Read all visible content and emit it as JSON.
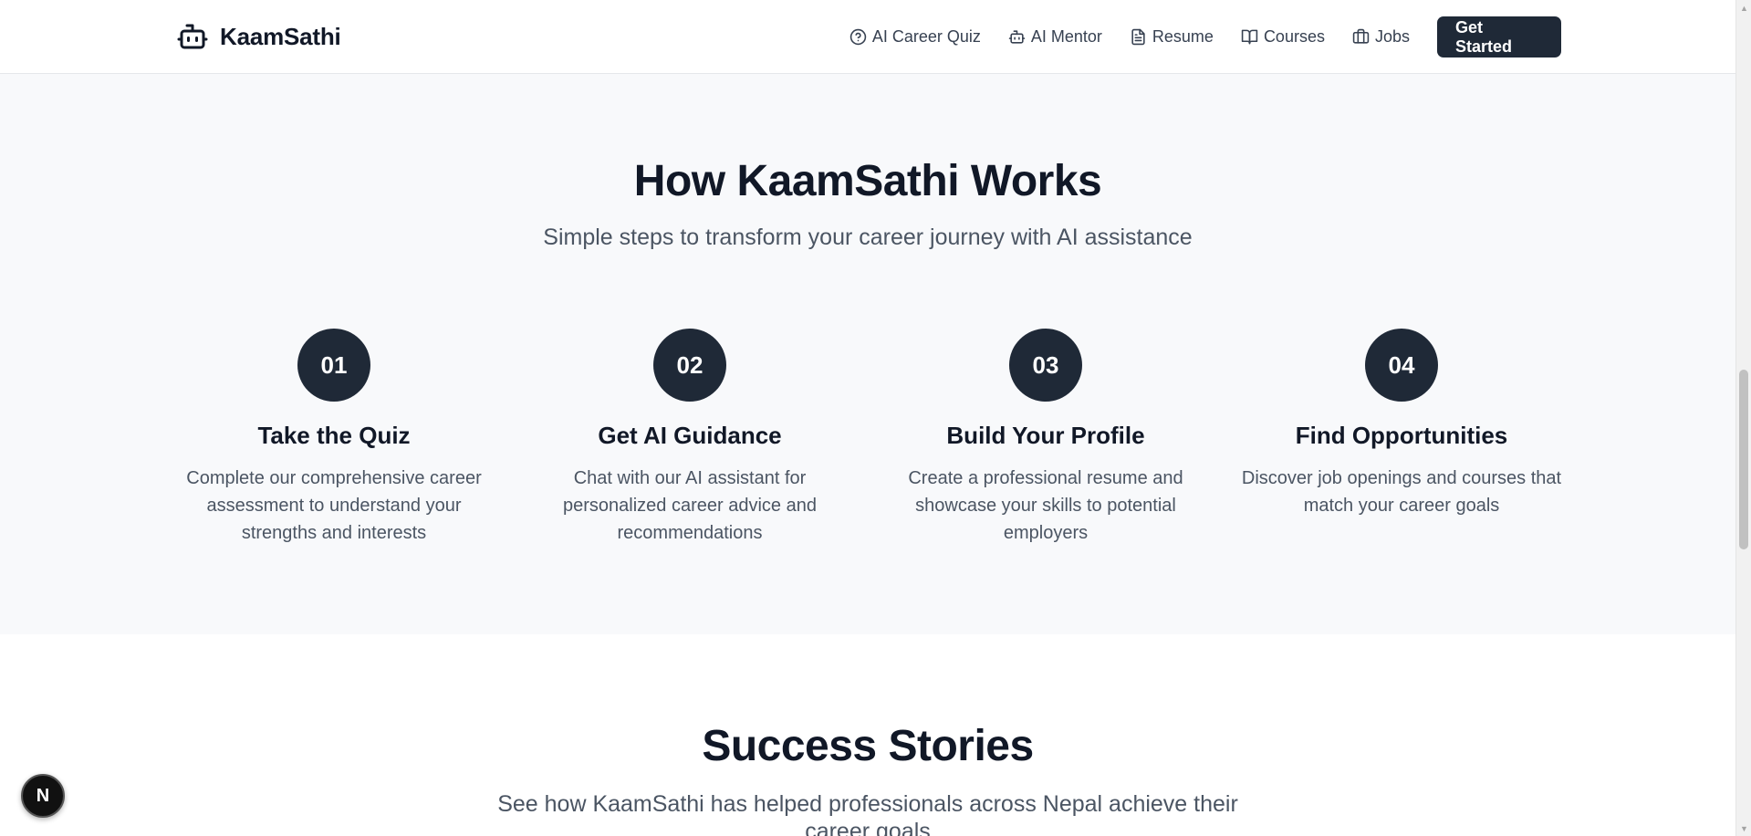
{
  "header": {
    "brand": "KaamSathi",
    "nav": [
      {
        "label": "AI Career Quiz",
        "icon": "help-circle-icon"
      },
      {
        "label": "AI Mentor",
        "icon": "bot-icon"
      },
      {
        "label": "Resume",
        "icon": "file-text-icon"
      },
      {
        "label": "Courses",
        "icon": "book-open-icon"
      },
      {
        "label": "Jobs",
        "icon": "briefcase-icon"
      }
    ],
    "cta": "Get Started"
  },
  "how": {
    "title": "How KaamSathi Works",
    "subtitle": "Simple steps to transform your career journey with AI assistance",
    "steps": [
      {
        "num": "01",
        "title": "Take the Quiz",
        "desc": "Complete our comprehensive career assessment to understand your strengths and interests"
      },
      {
        "num": "02",
        "title": "Get AI Guidance",
        "desc": "Chat with our AI assistant for personalized career advice and recommendations"
      },
      {
        "num": "03",
        "title": "Build Your Profile",
        "desc": "Create a professional resume and showcase your skills to potential employers"
      },
      {
        "num": "04",
        "title": "Find Opportunities",
        "desc": "Discover job openings and courses that match your career goals"
      }
    ]
  },
  "success": {
    "title": "Success Stories",
    "subtitle": "See how KaamSathi has helped professionals across Nepal achieve their career goals"
  },
  "badge": {
    "letter": "N"
  },
  "colors": {
    "primary": "#1f2937",
    "section_bg": "#f8f9fb",
    "text_muted": "#4b5563"
  }
}
